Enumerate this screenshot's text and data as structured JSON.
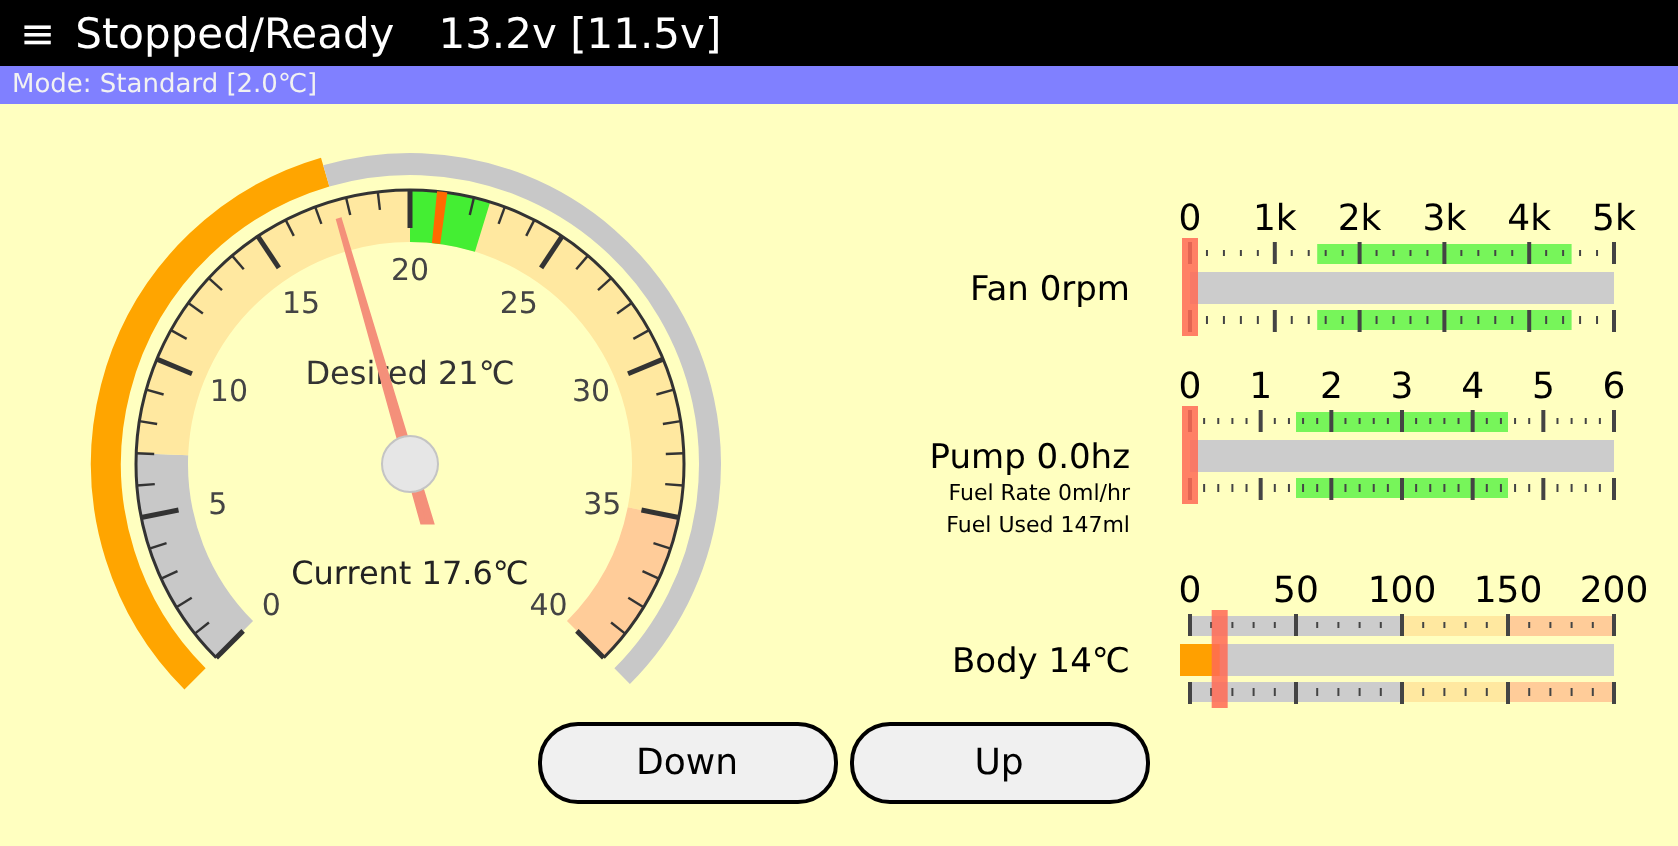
{
  "header": {
    "menu_icon": "≡",
    "status": "Stopped/Ready",
    "voltage": "13.2v [11.5v]"
  },
  "mode": "Mode: Standard [2.0℃]",
  "thermostat": {
    "scale_labels": [
      "0",
      "5",
      "10",
      "15",
      "20",
      "25",
      "30",
      "35",
      "40"
    ],
    "desired": {
      "label": "Desired 21℃",
      "level": 0.525
    },
    "current": {
      "label": "Current 17.6℃",
      "level": 0.44
    }
  },
  "meters": [
    {
      "kind": "speed",
      "label": "Fan 0rpm",
      "scale_labels": [
        "0",
        "1k",
        "2k",
        "3k",
        "4k",
        "5k"
      ],
      "level": 0
    },
    {
      "kind": "speed",
      "label": "Pump 0.0hz",
      "details": [
        "Fuel Rate 0ml/hr",
        "Fuel Used 147ml"
      ],
      "scale_labels": [
        "0",
        "1",
        "2",
        "3",
        "4",
        "5",
        "6"
      ],
      "level": 0
    },
    {
      "kind": "temperature",
      "label": "Body 14℃",
      "scale_labels": [
        "0",
        "50",
        "100",
        "150",
        "200"
      ],
      "level": 0.07
    }
  ],
  "buttons": [
    "Down",
    "Up"
  ]
}
